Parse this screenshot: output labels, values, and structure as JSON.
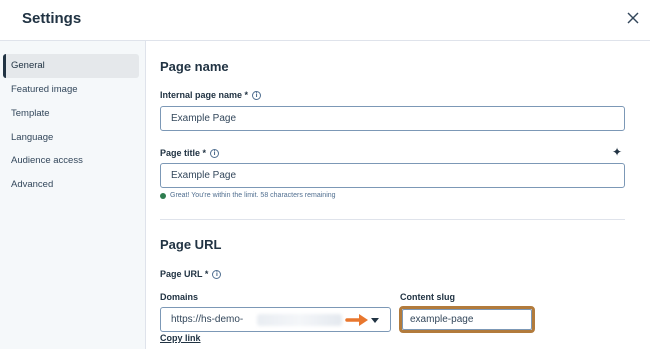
{
  "header": {
    "title": "Settings",
    "close_icon": "close-icon"
  },
  "sidebar": {
    "items": [
      {
        "label": "General",
        "active": true
      },
      {
        "label": "Featured image"
      },
      {
        "label": "Template"
      },
      {
        "label": "Language"
      },
      {
        "label": "Audience access"
      },
      {
        "label": "Advanced"
      }
    ]
  },
  "page_name": {
    "section_title": "Page name",
    "internal_label": "Internal page name *",
    "internal_value": "Example Page",
    "title_label": "Page title *",
    "title_value": "Example Page",
    "hint": "Great! You're within the limit. 58 characters remaining"
  },
  "page_url": {
    "section_title": "Page URL",
    "url_label": "Page URL *",
    "domains_label": "Domains",
    "domain_value": "https://hs-demo-",
    "slug_label": "Content slug",
    "slug_value": "example-page",
    "copy_link": "Copy link"
  },
  "colors": {
    "text": "#213343",
    "border": "#7c98b6",
    "highlight": "#b27b3c",
    "arrow": "#e8772e",
    "success": "#2e7d4f"
  }
}
